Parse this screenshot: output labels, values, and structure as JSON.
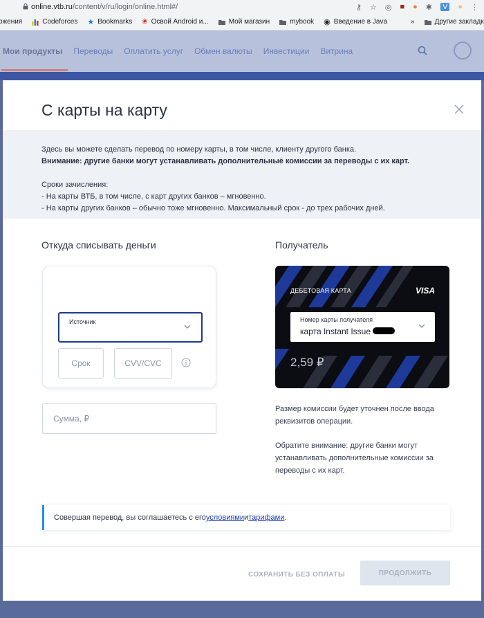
{
  "browser": {
    "url_host": "online.vtb.ru",
    "url_path": "/content/v/ru/login/online.html#/",
    "bookmarks": [
      {
        "label": "ожения",
        "icon": "none"
      },
      {
        "label": "Codeforces",
        "icon": "codeforces-icon",
        "color": "#1f8acb"
      },
      {
        "label": "Bookmarks",
        "icon": "star-icon",
        "color": "#1a73e8"
      },
      {
        "label": "Освой Android и...",
        "icon": "paw-icon",
        "color": "#d93025"
      },
      {
        "label": "Мой магазин",
        "icon": "folder-icon",
        "color": "#5f6368"
      },
      {
        "label": "mybook",
        "icon": "folder-icon",
        "color": "#5f6368"
      },
      {
        "label": "Введение в Java",
        "icon": "globe-icon",
        "color": "#3c4043"
      }
    ],
    "more": "»",
    "other_bookmarks": "Другие закладки"
  },
  "site_nav": {
    "items": [
      "Мои продукты",
      "Переводы",
      "Оплатить услуг",
      "Обмен валюты",
      "Инвестиции",
      "Витрина"
    ]
  },
  "modal": {
    "title": "С карты на карту",
    "info": {
      "line1": "Здесь вы можете сделать перевод по номеру карты, в том числе, клиенту другого банка.",
      "line2": "Внимание: другие банки могут устанавливать дополнительные комиссии за переводы с их карт.",
      "line3": "Сроки зачисления:",
      "line4": "- На карты ВТБ, в том числе, с карт других банков – мгновенно.",
      "line5": "- На карты других банков – обычно тоже мгновенно. Максимальный срок - до трех рабочих дней."
    },
    "from": {
      "title": "Откуда списывать деньги",
      "source_label": "Источник",
      "term_placeholder": "Срок",
      "cvv_placeholder": "CVV/CVC",
      "amount_placeholder": "Сумма, ₽"
    },
    "to": {
      "title": "Получатель",
      "card_type": "ДЕБЕТОВАЯ КАРТА",
      "card_brand": "VISA",
      "recipient_label": "Номер карты получателя",
      "recipient_value": "карта Instant Issue *",
      "balance": "2,59 ₽"
    },
    "notes": {
      "fee": "Размер комиссии будет уточнен после ввода реквизитов операции.",
      "warning": "Обратите внимание: другие банки могут устанавливать дополнительные комиссии за переводы с их карт."
    },
    "agreement": {
      "prefix": "Совершая перевод, вы соглашаетесь с его ",
      "terms_link": "условиями",
      "and": " и ",
      "tariffs_link": "тарифами",
      "suffix": "."
    },
    "buttons": {
      "save": "СОХРАНИТЬ БЕЗ ОПЛАТЫ",
      "next": "ПРОДОЛЖИТЬ"
    }
  },
  "colors": {
    "accent_blue": "#1f3a8c",
    "link": "#1a3bb0",
    "info_bg": "#eef2f7",
    "disabled_btn": "#dfe5ee"
  }
}
